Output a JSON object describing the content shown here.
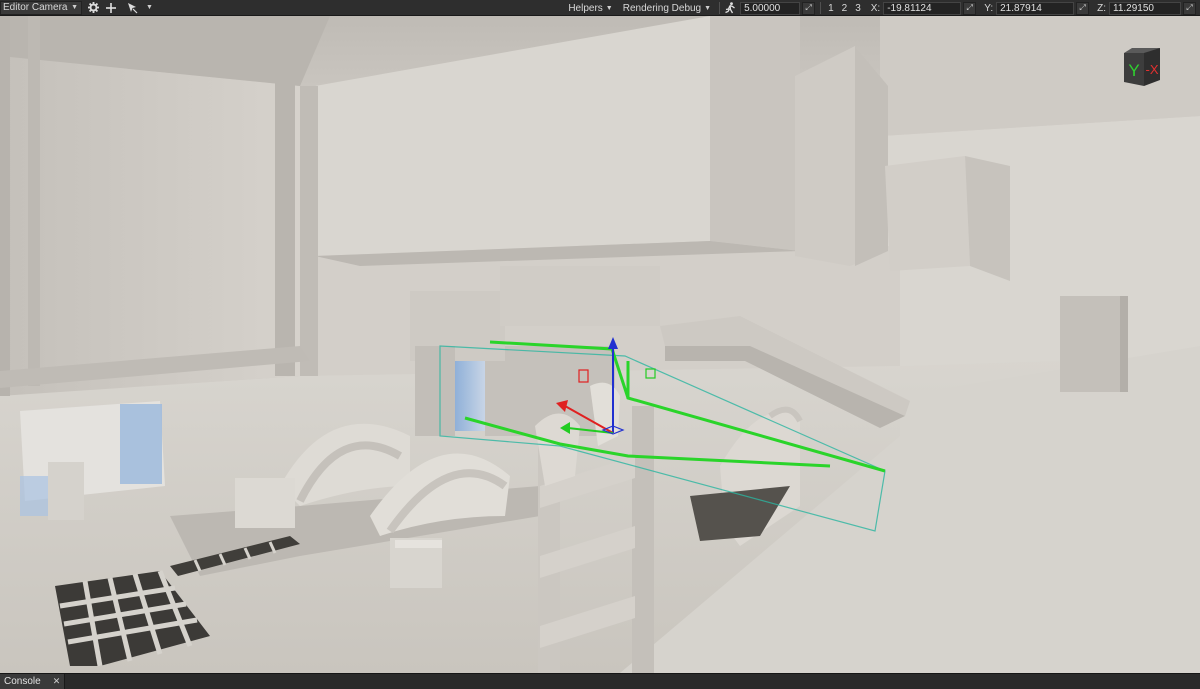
{
  "toolbar": {
    "camera_select": "Editor Camera",
    "helpers_label": "Helpers",
    "rendering_debug_label": "Rendering Debug",
    "speed_value": "5.00000",
    "layers": [
      "1",
      "2",
      "3"
    ],
    "x_label": "X:",
    "x_value": "-19.81124",
    "y_label": "Y:",
    "y_value": "21.87914",
    "z_label": "Z:",
    "z_value": "11.29150"
  },
  "nav_cube": {
    "y_label": "Y",
    "x_label": "-X",
    "y_color": "#2fd02f",
    "x_color": "#e23030"
  },
  "gizmo": {
    "x_color": "#e02020",
    "y_color": "#2030d0",
    "z_color": "#22cc22"
  },
  "selection_color": "#2ad42a",
  "bottom": {
    "console_tab": "Console"
  }
}
